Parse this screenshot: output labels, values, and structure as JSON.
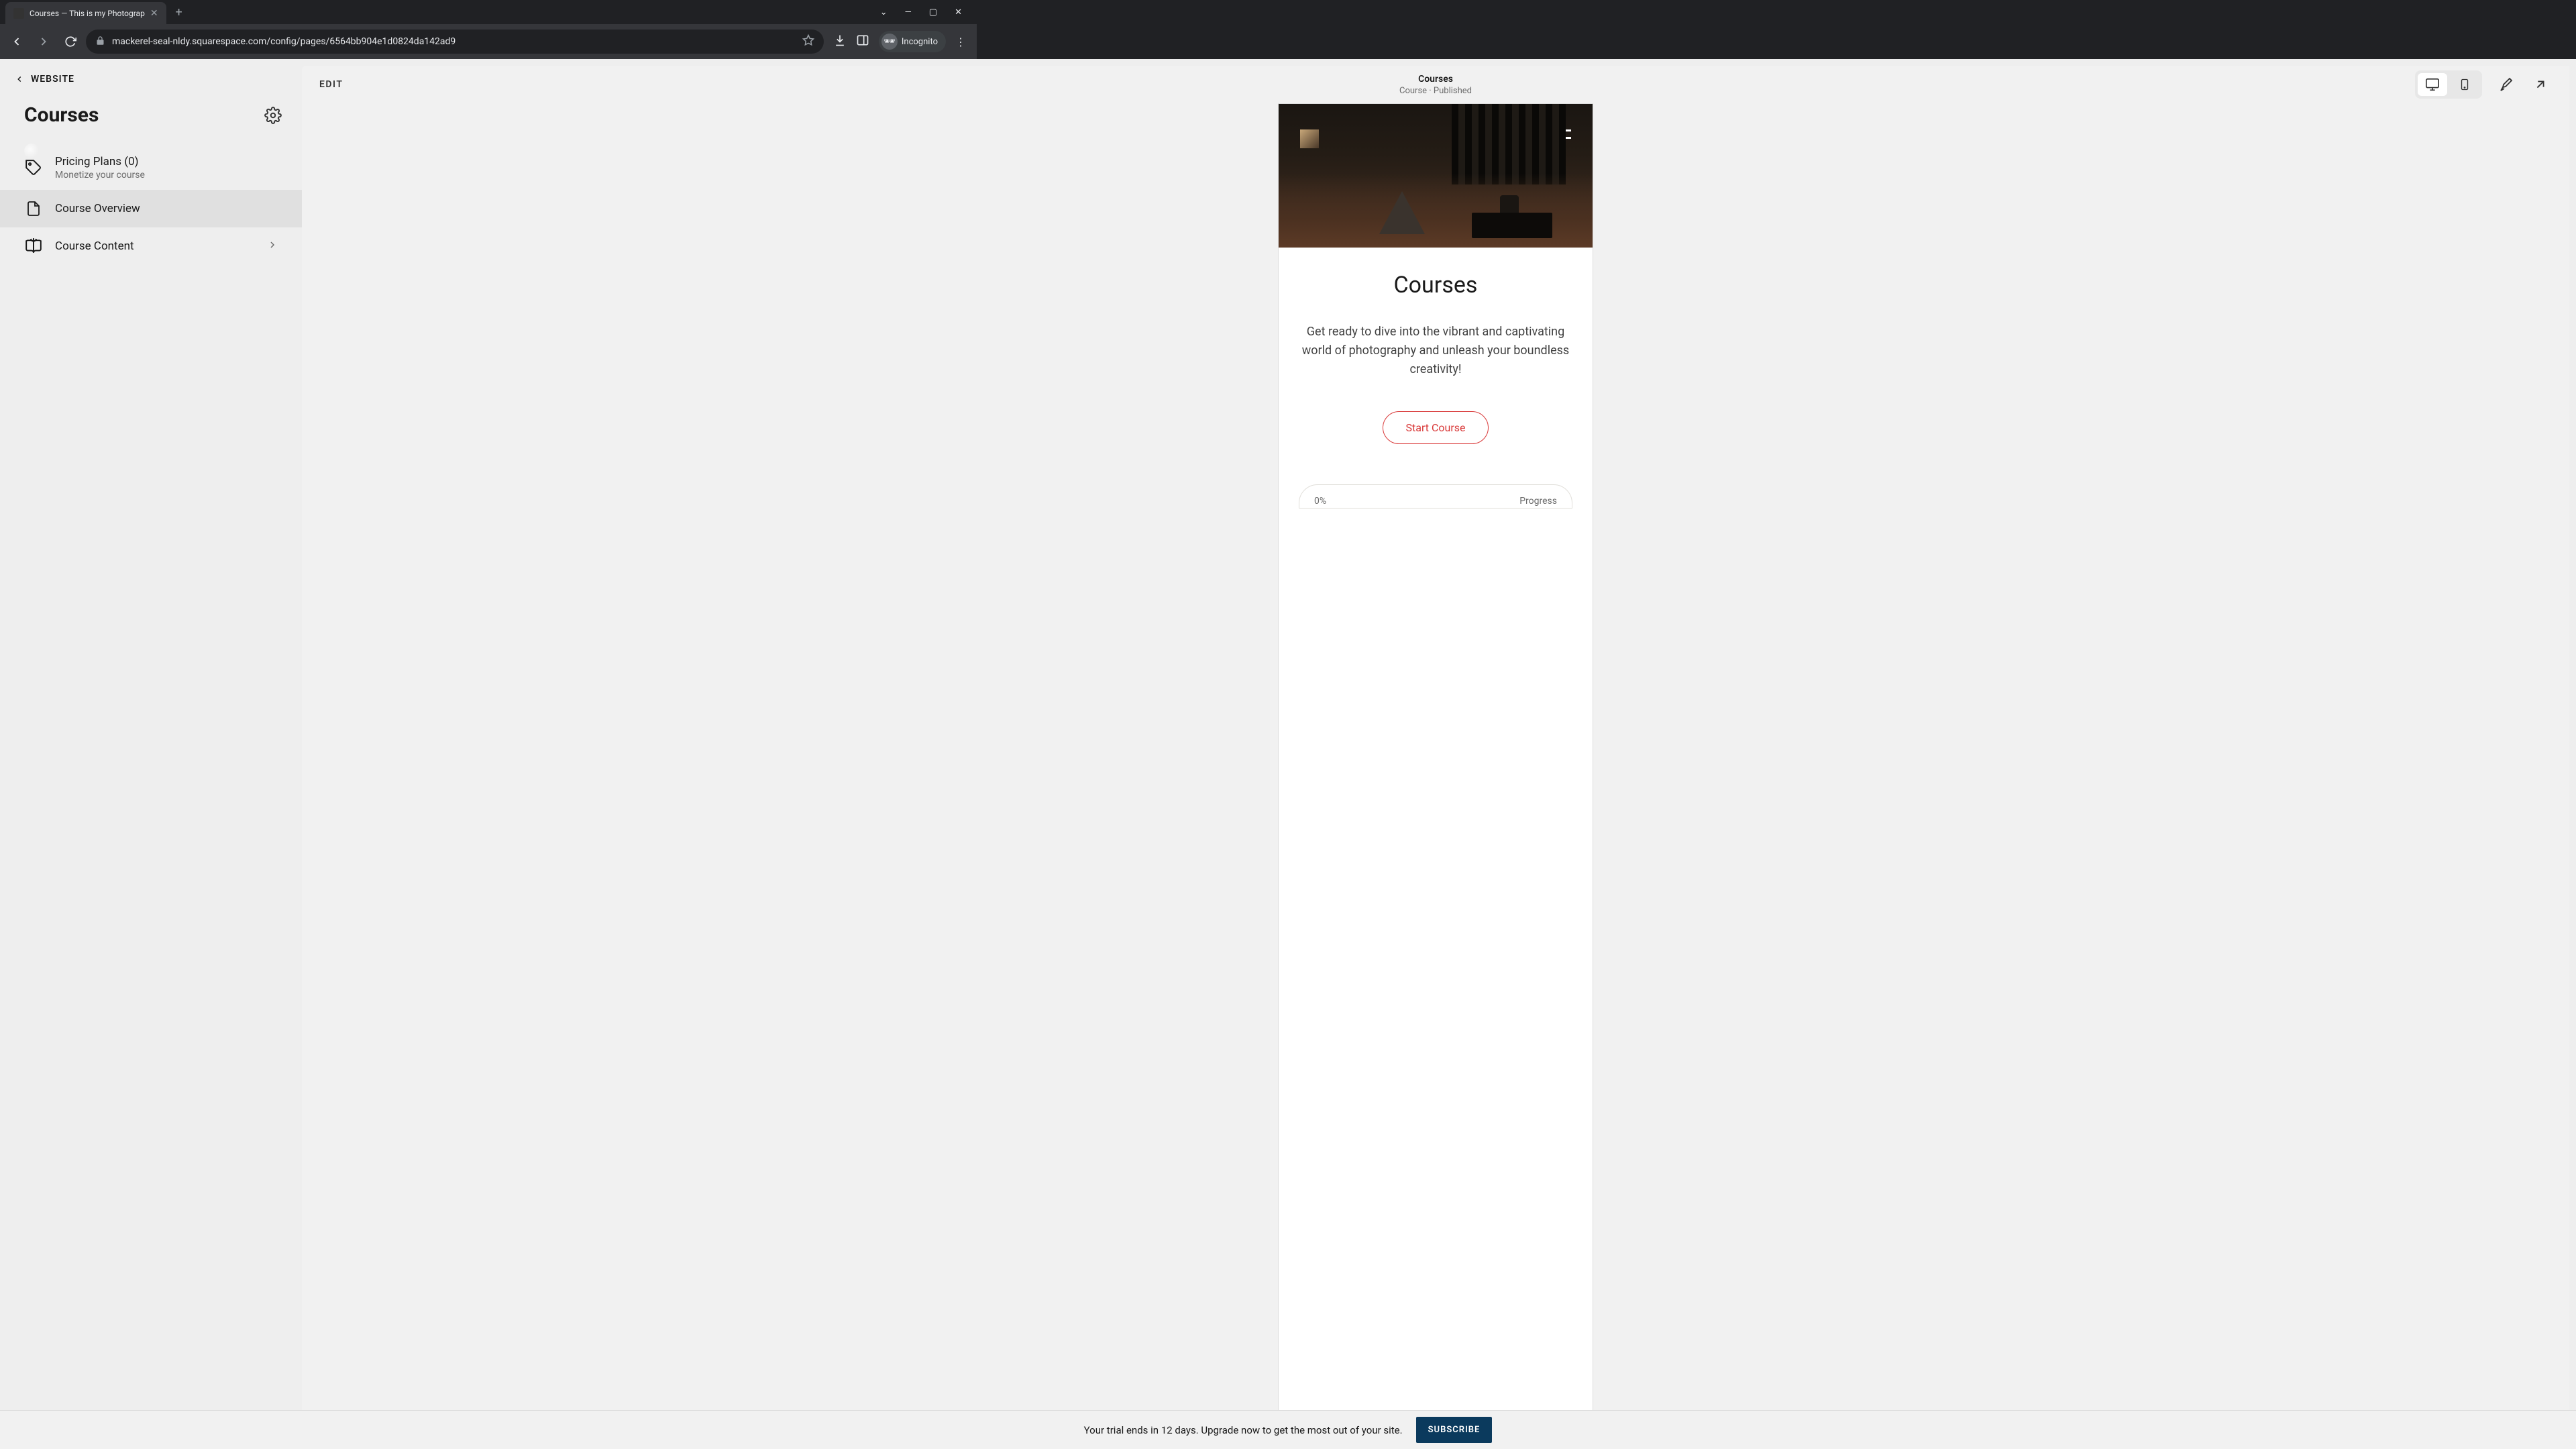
{
  "browser": {
    "tab_title": "Courses — This is my Photograp",
    "url": "mackerel-seal-nldy.squarespace.com/config/pages/6564bb904e1d0824da142ad9",
    "incognito_label": "Incognito"
  },
  "sidebar": {
    "back_label": "WEBSITE",
    "title": "Courses",
    "items": [
      {
        "title": "Pricing Plans (0)",
        "subtitle": "Monetize your course"
      },
      {
        "title": "Course Overview"
      },
      {
        "title": "Course Content"
      }
    ]
  },
  "preview": {
    "edit_label": "EDIT",
    "page_name": "Courses",
    "page_status": "Course · Published"
  },
  "site": {
    "heading": "Courses",
    "description": "Get ready to dive into the vibrant and captivating world of photography and unleash your boundless creativity!",
    "start_button": "Start Course",
    "progress_percent": "0%",
    "progress_label": "Progress"
  },
  "trial": {
    "message": "Your trial ends in 12 days. Upgrade now to get the most out of your site.",
    "button": "SUBSCRIBE"
  }
}
